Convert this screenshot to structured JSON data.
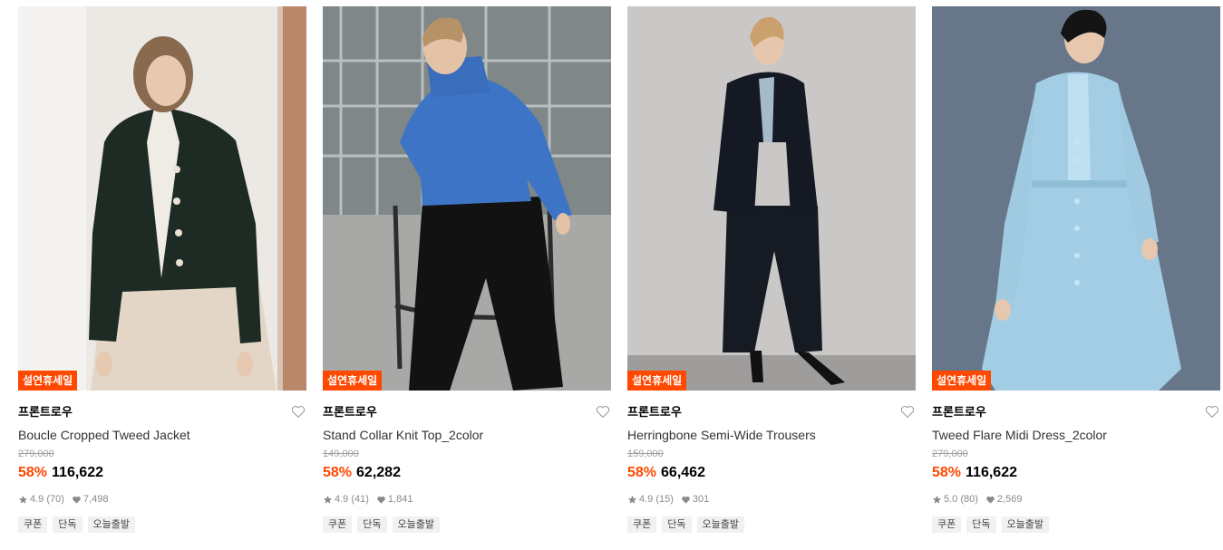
{
  "products": [
    {
      "badge": "설연휴세일",
      "brand": "프론트로우",
      "name": "Boucle Cropped Tweed Jacket",
      "original_price": "279,000",
      "discount": "58%",
      "price": "116,622",
      "rating": "4.9 (70)",
      "likes": "7,498",
      "tags": [
        "쿠폰",
        "단독",
        "오늘출발"
      ]
    },
    {
      "badge": "설연휴세일",
      "brand": "프론트로우",
      "name": "Stand Collar Knit Top_2color",
      "original_price": "149,000",
      "discount": "58%",
      "price": "62,282",
      "rating": "4.9 (41)",
      "likes": "1,841",
      "tags": [
        "쿠폰",
        "단독",
        "오늘출발"
      ]
    },
    {
      "badge": "설연휴세일",
      "brand": "프론트로우",
      "name": "Herringbone Semi-Wide Trousers",
      "original_price": "159,000",
      "discount": "58%",
      "price": "66,462",
      "rating": "4.9 (15)",
      "likes": "301",
      "tags": [
        "쿠폰",
        "단독",
        "오늘출발"
      ]
    },
    {
      "badge": "설연휴세일",
      "brand": "프론트로우",
      "name": "Tweed Flare Midi Dress_2color",
      "original_price": "279,000",
      "discount": "58%",
      "price": "116,622",
      "rating": "5.0 (80)",
      "likes": "2,569",
      "tags": [
        "쿠폰",
        "단독",
        "오늘출발"
      ]
    }
  ],
  "colors": {
    "accent": "#ff4800",
    "muted": "#8a8a8a",
    "tag_bg": "#f1f1f1"
  },
  "icons": {
    "wishlist": "heart-outline-icon",
    "rating": "star-icon",
    "likes": "heart-filled-icon"
  }
}
